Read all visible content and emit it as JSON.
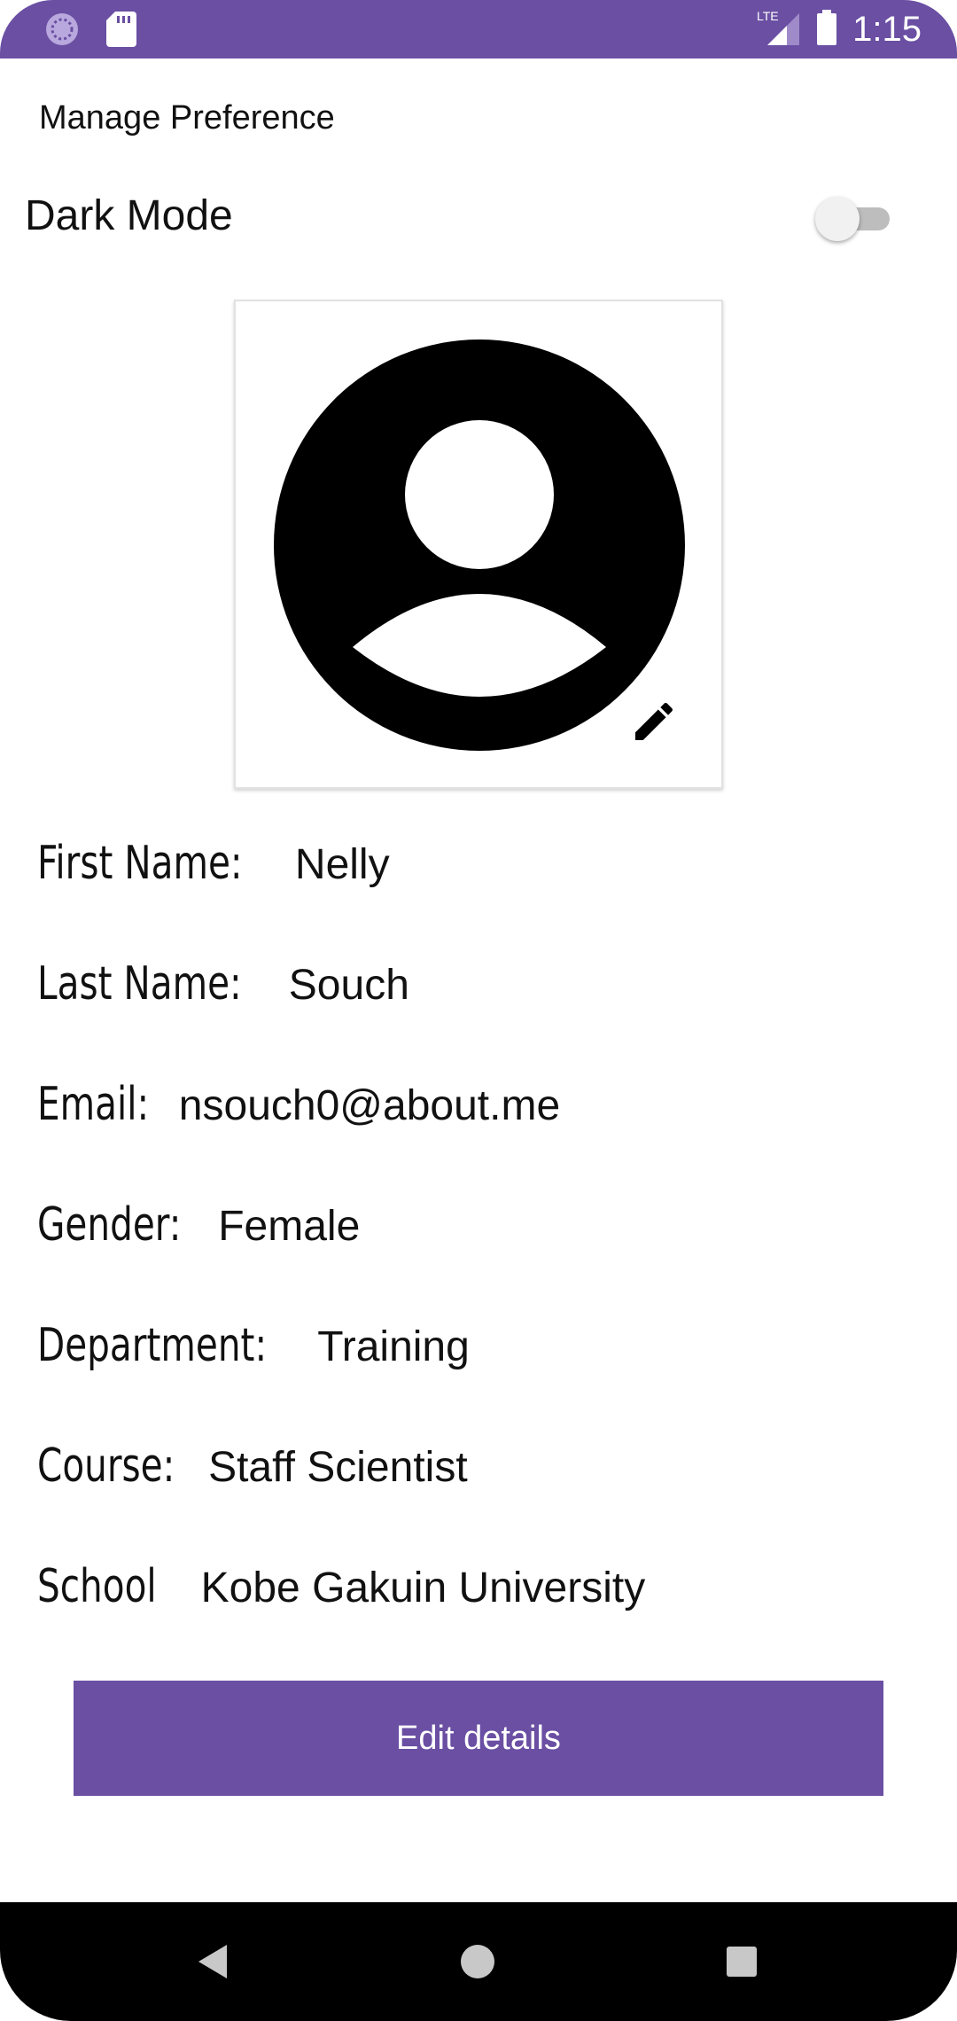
{
  "status_bar": {
    "time": "1:15",
    "network": "LTE",
    "icons": [
      "app-notification-icon",
      "sd-card-icon",
      "lte-signal-icon",
      "battery-icon"
    ]
  },
  "preferences": {
    "title": "Manage Preference",
    "dark_mode_label": "Dark Mode",
    "dark_mode_on": false
  },
  "profile": {
    "avatar_icon": "account-circle-icon",
    "edit_icon": "pencil-icon",
    "fields": [
      {
        "label": "First Name:",
        "value": "Nelly"
      },
      {
        "label": "Last Name:",
        "value": "Souch"
      },
      {
        "label": "Email:",
        "value": "nsouch0@about.me"
      },
      {
        "label": "Gender:",
        "value": "Female"
      },
      {
        "label": "Department:",
        "value": "Training"
      },
      {
        "label": "Course:",
        "value": "Staff Scientist"
      },
      {
        "label": "School",
        "value": "Kobe Gakuin University"
      }
    ]
  },
  "actions": {
    "edit_details_label": "Edit details"
  },
  "nav": {
    "icons": [
      "back-icon",
      "home-icon",
      "recents-icon"
    ]
  },
  "colors": {
    "accent": "#6a4fa3",
    "nav_background": "#000000"
  }
}
